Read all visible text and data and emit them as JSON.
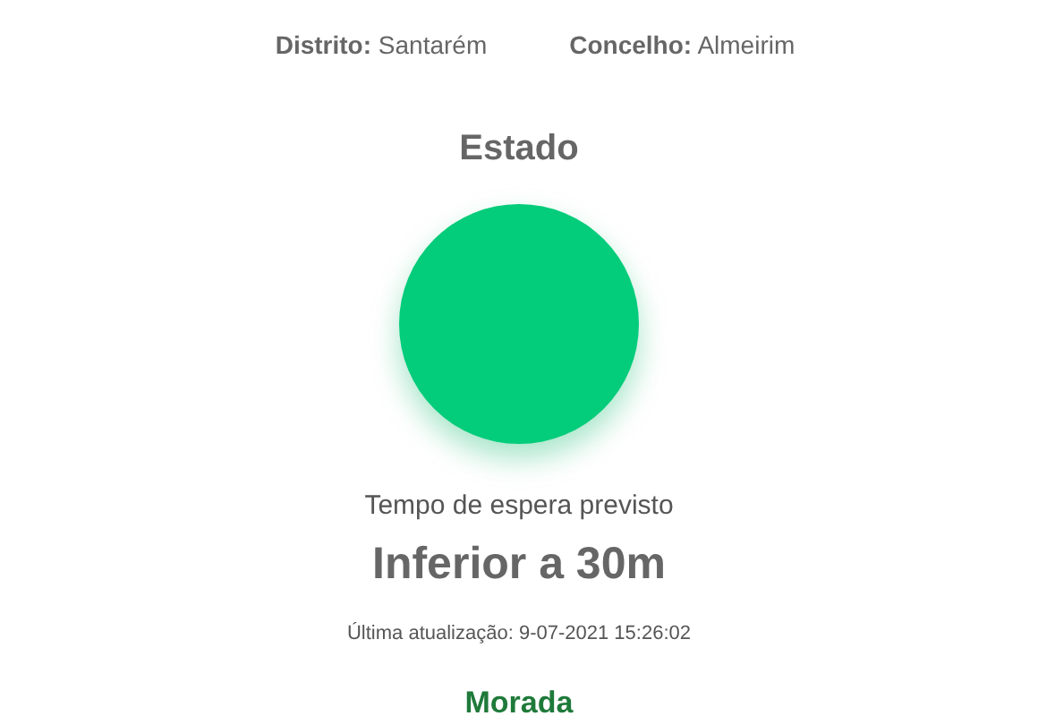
{
  "location": [
    {
      "text": "**Distrito:** Santarém"
    },
    {
      "text": "**Concelho:** Almeirim"
    }
  ],
  "status": {
    "title": "Estado",
    "color": "#03cc7a"
  },
  "wait": {
    "label": "Tempo de espera previsto",
    "value": "Inferior a 30m"
  },
  "last_update": "Última atualização: 9-07-2021 15:26:02",
  "address_title": "Morada"
}
